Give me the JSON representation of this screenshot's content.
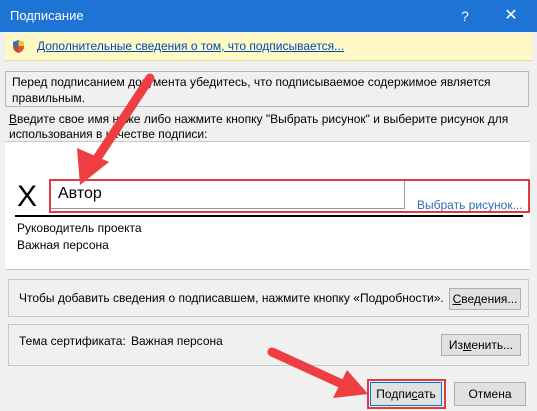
{
  "window": {
    "title": "Подписание",
    "help_label": "?",
    "close_label": "✕"
  },
  "infobar": {
    "link_text": "Дополнительные сведения о том, что подписывается..."
  },
  "warning": {
    "text": "Перед подписанием документа убедитесь, что подписываемое содержимое является правильным."
  },
  "instruction": {
    "accel": "В",
    "text": "ведите свое имя ниже либо нажмите кнопку \"Выбрать рисунок\" и выберите рисунок для использования в качестве подписи:"
  },
  "signature": {
    "x_mark": "X",
    "name_value": "Автор",
    "pick_image_label": "Выбрать рисунок...",
    "signer_title": "Руководитель проекта",
    "signer_name": "Важная персона"
  },
  "details": {
    "text": "Чтобы добавить сведения о подписавшем, нажмите кнопку «Подробности».",
    "button_accel": "С",
    "button_rest": "ведения..."
  },
  "certificate": {
    "label": "Тема сертификата:",
    "value": "Важная персона",
    "button_pre": "Из",
    "button_accel": "м",
    "button_rest": "енить..."
  },
  "actions": {
    "sign_pre": "Подпи",
    "sign_accel": "с",
    "sign_rest": "ать",
    "cancel_label": "Отмена"
  },
  "colors": {
    "titlebar": "#1e74d4",
    "infobar": "#fff9c6",
    "highlight": "#e03c40",
    "link": "#0048b8"
  }
}
